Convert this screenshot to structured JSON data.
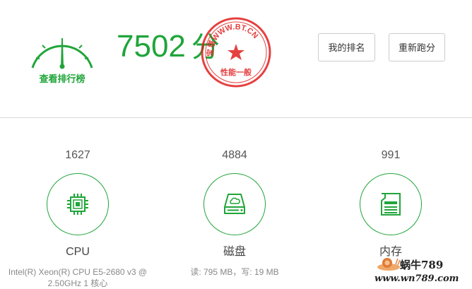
{
  "header": {
    "rank_link": "查看排行榜",
    "score": "7502",
    "score_unit": "分",
    "buttons": {
      "my_rank": "我的排名",
      "rerun": "重新跑分"
    },
    "stamp": {
      "top_text": "宝塔WWW.BT.CN",
      "bottom_text": "性能一般"
    }
  },
  "cards": [
    {
      "score": "1627",
      "icon": "cpu-icon",
      "name": "CPU",
      "desc": "Intel(R) Xeon(R) CPU E5-2680 v3 @ 2.50GHz 1 核心"
    },
    {
      "score": "4884",
      "icon": "disk-icon",
      "name": "磁盘",
      "desc": "读: 795 MB，写: 19 MB"
    },
    {
      "score": "991",
      "icon": "memory-icon",
      "name": "内存",
      "desc": ""
    }
  ],
  "watermark": {
    "line1": "蜗牛789",
    "line2": "www.wn789.com"
  },
  "colors": {
    "accent": "#20a53a",
    "stamp": "#e02020"
  }
}
